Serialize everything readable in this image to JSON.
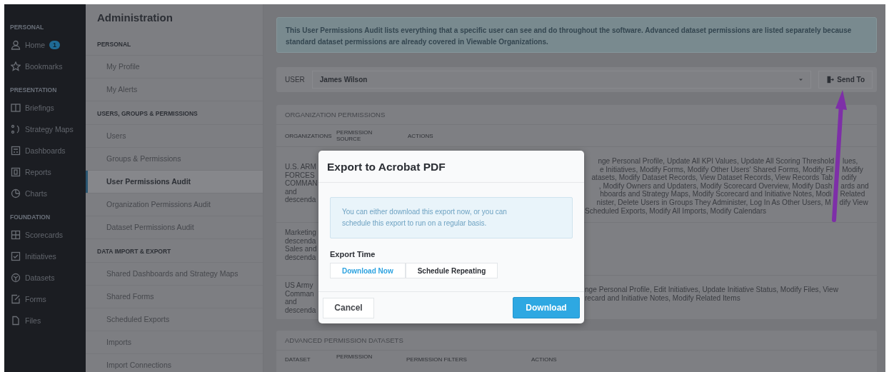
{
  "sidebar": {
    "sections": [
      {
        "title": "PERSONAL",
        "items": [
          {
            "label": "Home",
            "badge": "1"
          },
          {
            "label": "Bookmarks"
          }
        ]
      },
      {
        "title": "PRESENTATION",
        "items": [
          {
            "label": "Briefings"
          },
          {
            "label": "Strategy Maps"
          },
          {
            "label": "Dashboards"
          },
          {
            "label": "Reports"
          },
          {
            "label": "Charts"
          }
        ]
      },
      {
        "title": "FOUNDATION",
        "items": [
          {
            "label": "Scorecards"
          },
          {
            "label": "Initiatives"
          },
          {
            "label": "Datasets"
          },
          {
            "label": "Forms"
          },
          {
            "label": "Files"
          }
        ]
      }
    ]
  },
  "admin_nav": {
    "title": "Administration",
    "sections": [
      {
        "title": "PERSONAL",
        "items": [
          {
            "label": "My Profile",
            "selected": false
          },
          {
            "label": "My Alerts",
            "selected": false
          }
        ]
      },
      {
        "title": "USERS, GROUPS & PERMISSIONS",
        "items": [
          {
            "label": "Users",
            "selected": false
          },
          {
            "label": "Groups & Permissions",
            "selected": false
          },
          {
            "label": "User Permissions Audit",
            "selected": true
          },
          {
            "label": "Organization Permissions Audit",
            "selected": false
          },
          {
            "label": "Dataset Permissions Audit",
            "selected": false
          }
        ]
      },
      {
        "title": "DATA IMPORT & EXPORT",
        "items": [
          {
            "label": "Shared Dashboards and Strategy Maps",
            "selected": false
          },
          {
            "label": "Shared Forms",
            "selected": false
          },
          {
            "label": "Scheduled Exports",
            "selected": false
          },
          {
            "label": "Imports",
            "selected": false
          },
          {
            "label": "Import Connections",
            "selected": false
          }
        ]
      }
    ]
  },
  "info_banner": "This User Permissions Audit lists everything that a specific user can see and do throughout the software. Advanced dataset permissions are listed separately because standard dataset permissions are already covered in Viewable Organizations.",
  "user_bar": {
    "label": "USER",
    "value": "James Wilson",
    "button": "Send To"
  },
  "organization_permissions": {
    "title": "ORGANIZATION PERMISSIONS",
    "columns": [
      "ORGANIZATIONS",
      "PERMISSION SOURCE",
      "ACTIONS"
    ],
    "rows": [
      {
        "organizations": [
          "U.S. ARM",
          "FORCES",
          "COMMAN",
          "and",
          "descenda"
        ],
        "actions": [
          [
            "nge Personal Profile, Update All KPI Values, Update All Scoring Threshold",
            "lues,"
          ],
          [
            "e Initiatives, Modify Forms, Modify Other Users' Shared Forms, Modify Fil",
            "Modify"
          ],
          [
            "atasets, Modify Dataset Records, View Dataset Records, View Records Tab",
            "odify"
          ],
          [
            ", Modify Owners and Updaters, Modify Scorecard Overview, Modify Dash",
            "ards and"
          ],
          [
            "hboards and Strategy Maps, Modify Scorecard and Initiative Notes, Modi",
            "Related"
          ],
          [
            "nister, Delete Users in Groups They Administer, Log In As Other Users, M",
            "dify View"
          ],
          "Scheduled Exports, Modify All Imports, Modify Calendars"
        ]
      },
      {
        "organizations": [
          "Marketing",
          "descenda",
          "Sales and",
          "descenda"
        ]
      },
      {
        "organizations": [
          "US Army",
          "Comman",
          "and",
          "descenda"
        ],
        "actions": [
          "nge Personal Profile, Edit Initiatives, Update Initiative Status, Modify Files, View",
          "recard and Initiative Notes, Modify Related Items"
        ]
      }
    ]
  },
  "advanced_permissions": {
    "title": "ADVANCED PERMISSION DATASETS",
    "columns": [
      "DATASET",
      "PERMISSION",
      "PERMISSION FILTERS",
      "ACTIONS"
    ]
  },
  "modal": {
    "title": "Export to Acrobat PDF",
    "message": "You can either download this export now, or you can schedule this export to run on a regular basis.",
    "field_label": "Export Time",
    "options": [
      {
        "label": "Download Now",
        "selected": true
      },
      {
        "label": "Schedule Repeating",
        "selected": false
      }
    ],
    "cancel": "Cancel",
    "confirm": "Download"
  }
}
